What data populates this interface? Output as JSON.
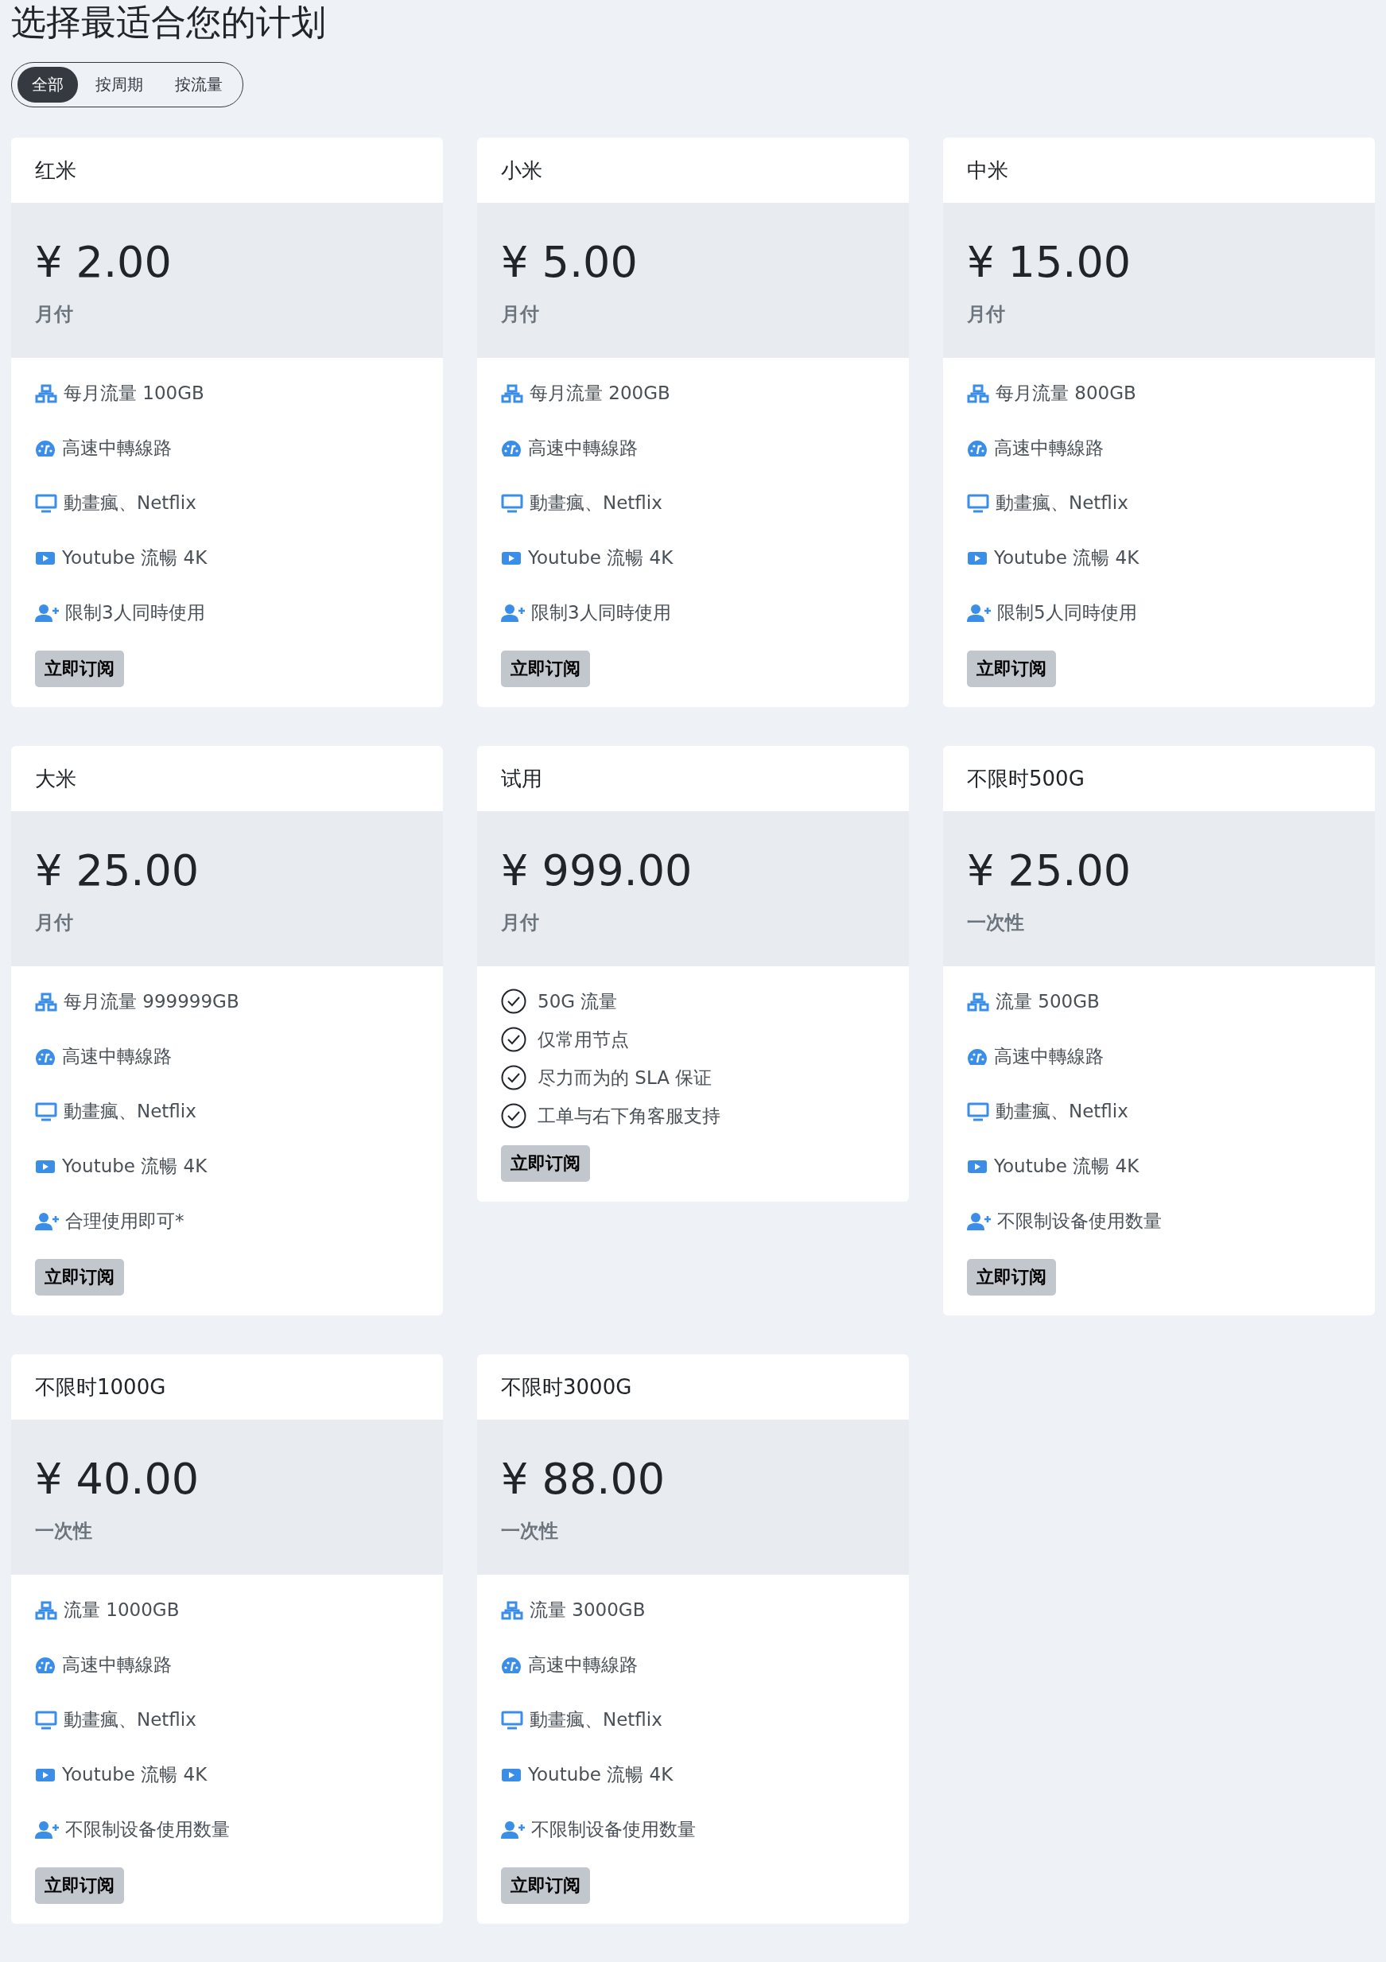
{
  "title": "选择最适合您的计划",
  "tabs": [
    {
      "label": "全部",
      "selected": true
    },
    {
      "label": "按周期",
      "selected": false
    },
    {
      "label": "按流量",
      "selected": false
    }
  ],
  "plans": [
    {
      "name": "红米",
      "price": "¥ 2.00",
      "period": "月付",
      "features": [
        {
          "kind": "traffic",
          "text": "每月流量 100GB"
        },
        {
          "kind": "speed",
          "text": "高速中轉線路"
        },
        {
          "kind": "screen",
          "text": "動畫瘋、Netflix"
        },
        {
          "kind": "video",
          "text": "Youtube 流暢 4K"
        },
        {
          "kind": "users",
          "text": "限制3人同時使用"
        }
      ],
      "button": "立即订阅"
    },
    {
      "name": "小米",
      "price": "¥ 5.00",
      "period": "月付",
      "features": [
        {
          "kind": "traffic",
          "text": "每月流量 200GB"
        },
        {
          "kind": "speed",
          "text": "高速中轉線路"
        },
        {
          "kind": "screen",
          "text": "動畫瘋、Netflix"
        },
        {
          "kind": "video",
          "text": "Youtube 流暢 4K"
        },
        {
          "kind": "users",
          "text": "限制3人同時使用"
        }
      ],
      "button": "立即订阅"
    },
    {
      "name": "中米",
      "price": "¥ 15.00",
      "period": "月付",
      "features": [
        {
          "kind": "traffic",
          "text": "每月流量 800GB"
        },
        {
          "kind": "speed",
          "text": "高速中轉線路"
        },
        {
          "kind": "screen",
          "text": "動畫瘋、Netflix"
        },
        {
          "kind": "video",
          "text": "Youtube 流暢 4K"
        },
        {
          "kind": "users",
          "text": "限制5人同時使用"
        }
      ],
      "button": "立即订阅"
    },
    {
      "name": "大米",
      "price": "¥ 25.00",
      "period": "月付",
      "features": [
        {
          "kind": "traffic",
          "text": "每月流量 999999GB"
        },
        {
          "kind": "speed",
          "text": "高速中轉線路"
        },
        {
          "kind": "screen",
          "text": "動畫瘋、Netflix"
        },
        {
          "kind": "video",
          "text": "Youtube 流暢 4K"
        },
        {
          "kind": "users",
          "text": "合理使用即可*"
        }
      ],
      "button": "立即订阅"
    },
    {
      "name": "试用",
      "price": "¥ 999.00",
      "period": "月付",
      "features": [
        {
          "kind": "check",
          "text": "50G 流量"
        },
        {
          "kind": "check",
          "text": "仅常用节点"
        },
        {
          "kind": "check",
          "text": "尽力而为的 SLA 保证"
        },
        {
          "kind": "check",
          "text": "工单与右下角客服支持"
        }
      ],
      "button": "立即订阅"
    },
    {
      "name": "不限时500G",
      "price": "¥ 25.00",
      "period": "一次性",
      "features": [
        {
          "kind": "traffic",
          "text": "流量 500GB"
        },
        {
          "kind": "speed",
          "text": "高速中轉線路"
        },
        {
          "kind": "screen",
          "text": "動畫瘋、Netflix"
        },
        {
          "kind": "video",
          "text": "Youtube 流暢 4K"
        },
        {
          "kind": "users",
          "text": "不限制设备使用数量"
        }
      ],
      "button": "立即订阅"
    },
    {
      "name": "不限时1000G",
      "price": "¥ 40.00",
      "period": "一次性",
      "features": [
        {
          "kind": "traffic",
          "text": "流量 1000GB"
        },
        {
          "kind": "speed",
          "text": "高速中轉線路"
        },
        {
          "kind": "screen",
          "text": "動畫瘋、Netflix"
        },
        {
          "kind": "video",
          "text": "Youtube 流暢 4K"
        },
        {
          "kind": "users",
          "text": "不限制设备使用数量"
        }
      ],
      "button": "立即订阅"
    },
    {
      "name": "不限时3000G",
      "price": "¥ 88.00",
      "period": "一次性",
      "features": [
        {
          "kind": "traffic",
          "text": "流量 3000GB"
        },
        {
          "kind": "speed",
          "text": "高速中轉線路"
        },
        {
          "kind": "screen",
          "text": "動畫瘋、Netflix"
        },
        {
          "kind": "video",
          "text": "Youtube 流暢 4K"
        },
        {
          "kind": "users",
          "text": "不限制设备使用数量"
        }
      ],
      "button": "立即订阅"
    }
  ]
}
